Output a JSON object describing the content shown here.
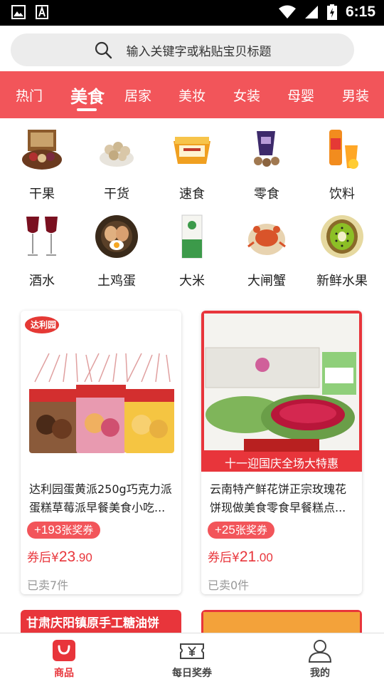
{
  "status_bar": {
    "time": "6:15",
    "icons": [
      "image-icon",
      "font-icon",
      "wifi-icon",
      "signal-icon",
      "battery-icon"
    ]
  },
  "search": {
    "placeholder": "输入关键字或粘贴宝贝标题"
  },
  "tabs": [
    {
      "label": "热门",
      "active": false
    },
    {
      "label": "美食",
      "active": true
    },
    {
      "label": "居家",
      "active": false
    },
    {
      "label": "美妆",
      "active": false
    },
    {
      "label": "女装",
      "active": false
    },
    {
      "label": "母婴",
      "active": false
    },
    {
      "label": "男装",
      "active": false
    }
  ],
  "categories": [
    {
      "label": "干果",
      "icon": "dried-fruit-icon"
    },
    {
      "label": "干货",
      "icon": "dry-goods-icon"
    },
    {
      "label": "速食",
      "icon": "instant-food-icon"
    },
    {
      "label": "零食",
      "icon": "snack-icon"
    },
    {
      "label": "饮料",
      "icon": "drink-icon"
    },
    {
      "label": "酒水",
      "icon": "wine-icon"
    },
    {
      "label": "土鸡蛋",
      "icon": "egg-icon"
    },
    {
      "label": "大米",
      "icon": "rice-icon"
    },
    {
      "label": "大闸蟹",
      "icon": "crab-icon"
    },
    {
      "label": "新鲜水果",
      "icon": "kiwi-icon"
    }
  ],
  "products": [
    {
      "title": "达利园蛋黄派250g巧克力派蛋糕草莓派早餐美食小吃...",
      "brand_logo": "达利园",
      "reward_num": "+193",
      "reward_unit": "张奖券",
      "price_prefix": "券后¥",
      "price_int": "23",
      "price_dec": ".90",
      "sold": "已卖7件"
    },
    {
      "title": "云南特产鲜花饼正宗玫瑰花饼现做美食零食早餐糕点...",
      "banner": "十一迎国庆全场大特惠",
      "reward_num": "+25",
      "reward_unit": "张奖券",
      "price_prefix": "券后¥",
      "price_int": "21",
      "price_dec": ".00",
      "sold": "已卖0件"
    }
  ],
  "partial_products": [
    {
      "banner": "甘肃庆阳镇原手工糖油饼"
    },
    {
      "banner": ""
    }
  ],
  "bottom_nav": [
    {
      "label": "商品",
      "icon": "shopping-bag-icon",
      "active": true
    },
    {
      "label": "每日奖券",
      "icon": "ticket-icon",
      "active": false
    },
    {
      "label": "我的",
      "icon": "person-icon",
      "active": false
    }
  ],
  "colors": {
    "brand_red": "#f2555a",
    "price_red": "#e8353b",
    "search_bg": "#ececec"
  }
}
